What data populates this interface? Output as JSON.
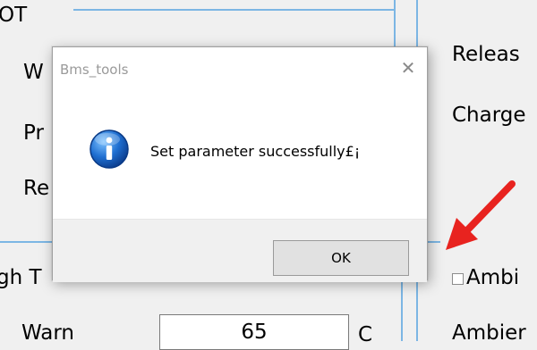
{
  "background": {
    "left_labels": {
      "row0": "OT",
      "row1": "W",
      "row2": "Pr",
      "row3": "Re",
      "row4": "gh T",
      "row5": "Warn"
    },
    "right_labels": {
      "release": "Releas",
      "charge": "Charge",
      "ambient_checkbox_label": "Ambi",
      "ambient2": "Ambier"
    },
    "warn_value": "65",
    "warn_unit": "C"
  },
  "dialog": {
    "title": "Bms_tools",
    "close_glyph": "✕",
    "message": "Set parameter successfully£¡",
    "ok_label": "OK",
    "icon": "info-icon"
  },
  "colors": {
    "accent_line": "#7cb6e4",
    "arrow": "#e8231f"
  }
}
